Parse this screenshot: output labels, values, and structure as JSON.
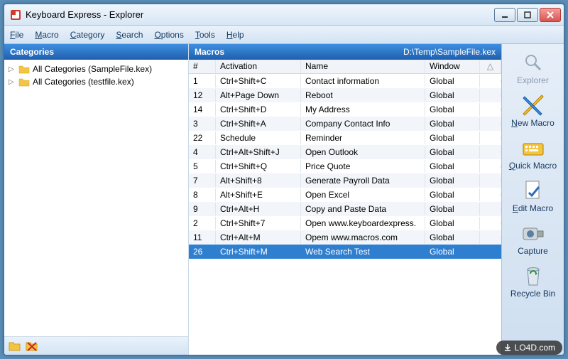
{
  "window": {
    "title": "Keyboard Express - Explorer"
  },
  "menu": {
    "file": "File",
    "macro": "Macro",
    "category": "Category",
    "search": "Search",
    "options": "Options",
    "tools": "Tools",
    "help": "Help"
  },
  "categories": {
    "header": "Categories",
    "items": [
      {
        "label": "All Categories (SampleFile.kex)"
      },
      {
        "label": "All Categories (testfile.kex)"
      }
    ]
  },
  "macros": {
    "header": "Macros",
    "path": "D:\\Temp\\SampleFile.kex",
    "columns": {
      "num": "#",
      "activation": "Activation",
      "name": "Name",
      "window": "Window"
    },
    "rows": [
      {
        "num": "1",
        "activation": "Ctrl+Shift+C",
        "name": "Contact information",
        "window": "Global",
        "selected": false
      },
      {
        "num": "12",
        "activation": "Alt+Page Down",
        "name": "Reboot",
        "window": "Global",
        "selected": false
      },
      {
        "num": "14",
        "activation": "Ctrl+Shift+D",
        "name": "My Address",
        "window": "Global",
        "selected": false
      },
      {
        "num": "3",
        "activation": "Ctrl+Shift+A",
        "name": "Company Contact Info",
        "window": "Global",
        "selected": false
      },
      {
        "num": "22",
        "activation": "Schedule",
        "name": "Reminder",
        "window": "Global",
        "selected": false
      },
      {
        "num": "4",
        "activation": "Ctrl+Alt+Shift+J",
        "name": "Open Outlook",
        "window": "Global",
        "selected": false
      },
      {
        "num": "5",
        "activation": "Ctrl+Shift+Q",
        "name": "Price Quote",
        "window": "Global",
        "selected": false
      },
      {
        "num": "7",
        "activation": "Alt+Shift+8",
        "name": "Generate Payroll Data",
        "window": "Global",
        "selected": false
      },
      {
        "num": "8",
        "activation": "Alt+Shift+E",
        "name": "Open Excel",
        "window": "Global",
        "selected": false
      },
      {
        "num": "9",
        "activation": "Ctrl+Alt+H",
        "name": "Copy and Paste Data",
        "window": "Global",
        "selected": false
      },
      {
        "num": "2",
        "activation": "Ctrl+Shift+7",
        "name": "Open www.keyboardexpress.",
        "window": "Global",
        "selected": false
      },
      {
        "num": "11",
        "activation": "Ctrl+Alt+M",
        "name": "Opem www.macros.com",
        "window": "Global",
        "selected": false
      },
      {
        "num": "26",
        "activation": "Ctrl+Shift+M",
        "name": "Web Search Test",
        "window": "Global",
        "selected": true
      }
    ]
  },
  "toolbar": {
    "explorer": "Explorer",
    "new_macro": "New Macro",
    "quick_macro": "Quick Macro",
    "edit_macro": "Edit Macro",
    "capture": "Capture",
    "recycle_bin": "Recycle Bin"
  },
  "watermark": "LO4D.com"
}
